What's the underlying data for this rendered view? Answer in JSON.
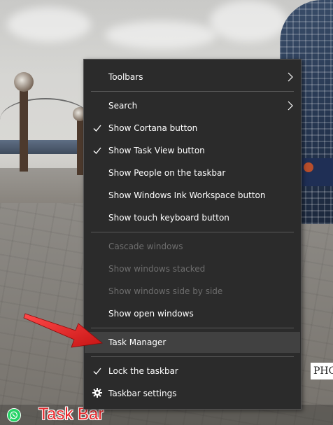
{
  "context_menu": {
    "items": [
      {
        "label": "Toolbars",
        "submenu": true,
        "checked": false,
        "enabled": true
      },
      {
        "label": "Search",
        "submenu": true,
        "checked": false,
        "enabled": true
      },
      {
        "label": "Show Cortana button",
        "submenu": false,
        "checked": true,
        "enabled": true
      },
      {
        "label": "Show Task View button",
        "submenu": false,
        "checked": true,
        "enabled": true
      },
      {
        "label": "Show People on the taskbar",
        "submenu": false,
        "checked": false,
        "enabled": true
      },
      {
        "label": "Show Windows Ink Workspace button",
        "submenu": false,
        "checked": false,
        "enabled": true
      },
      {
        "label": "Show touch keyboard button",
        "submenu": false,
        "checked": false,
        "enabled": true
      },
      {
        "label": "Cascade windows",
        "submenu": false,
        "checked": false,
        "enabled": false
      },
      {
        "label": "Show windows stacked",
        "submenu": false,
        "checked": false,
        "enabled": false
      },
      {
        "label": "Show windows side by side",
        "submenu": false,
        "checked": false,
        "enabled": false
      },
      {
        "label": "Show open windows",
        "submenu": false,
        "checked": false,
        "enabled": true
      },
      {
        "label": "Task Manager",
        "submenu": false,
        "checked": false,
        "enabled": true,
        "highlighted": true
      },
      {
        "label": "Lock the taskbar",
        "submenu": false,
        "checked": true,
        "enabled": true
      },
      {
        "label": "Taskbar settings",
        "submenu": false,
        "checked": false,
        "enabled": true,
        "icon": "gear-icon"
      }
    ]
  },
  "annotation": {
    "caption": "Task Bar",
    "color": "#e8262a",
    "arrow_icon": "red-arrow-icon"
  },
  "taskbar": {
    "pinned_icon": "whatsapp-icon"
  },
  "wallpaper": {
    "corner_text": "PHO"
  },
  "colors": {
    "menu_bg": "#2b2b2b",
    "menu_hover": "#414141",
    "menu_text": "#ffffff",
    "menu_disabled_text": "#6d6d6d",
    "separator": "#5a5a5a"
  }
}
